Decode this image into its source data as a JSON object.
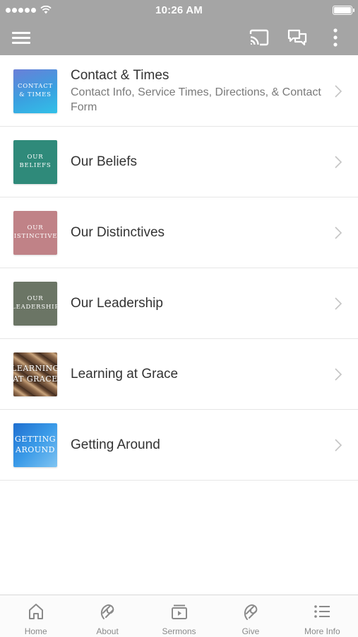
{
  "status_bar": {
    "time": "10:26 AM"
  },
  "app_bar": {
    "icons": [
      "menu-icon",
      "cast-icon",
      "chat-icon",
      "more-vert-icon"
    ]
  },
  "list": {
    "items": [
      {
        "title": "Contact & Times",
        "subtitle": "Contact Info, Service Times, Directions, & Contact Form",
        "thumb_text": "Contact & Times",
        "thumb_color": "#4a8fd6"
      },
      {
        "title": "Our Beliefs",
        "subtitle": "",
        "thumb_text": "Our Beliefs",
        "thumb_color": "#2f8a7a"
      },
      {
        "title": "Our Distinctives",
        "subtitle": "",
        "thumb_text": "Our Distinctives",
        "thumb_color": "#c08287"
      },
      {
        "title": "Our Leadership",
        "subtitle": "",
        "thumb_text": "Our Leadership",
        "thumb_color": "#6b7565"
      },
      {
        "title": "Learning at Grace",
        "subtitle": "",
        "thumb_text": "Learning at Grace",
        "thumb_color": "#8a6a52"
      },
      {
        "title": "Getting Around",
        "subtitle": "",
        "thumb_text": "Getting Around",
        "thumb_color": "#3a8fe0"
      }
    ]
  },
  "tab_bar": {
    "tabs": [
      {
        "label": "Home",
        "icon": "home-icon"
      },
      {
        "label": "About",
        "icon": "about-icon"
      },
      {
        "label": "Sermons",
        "icon": "sermons-icon"
      },
      {
        "label": "Give",
        "icon": "give-icon"
      },
      {
        "label": "More Info",
        "icon": "list-icon"
      }
    ]
  },
  "colors": {
    "header_gray": "#a5a5a5",
    "text_primary": "#333333",
    "text_secondary": "#7a7a7a",
    "tab_gray": "#8a8a8a"
  }
}
